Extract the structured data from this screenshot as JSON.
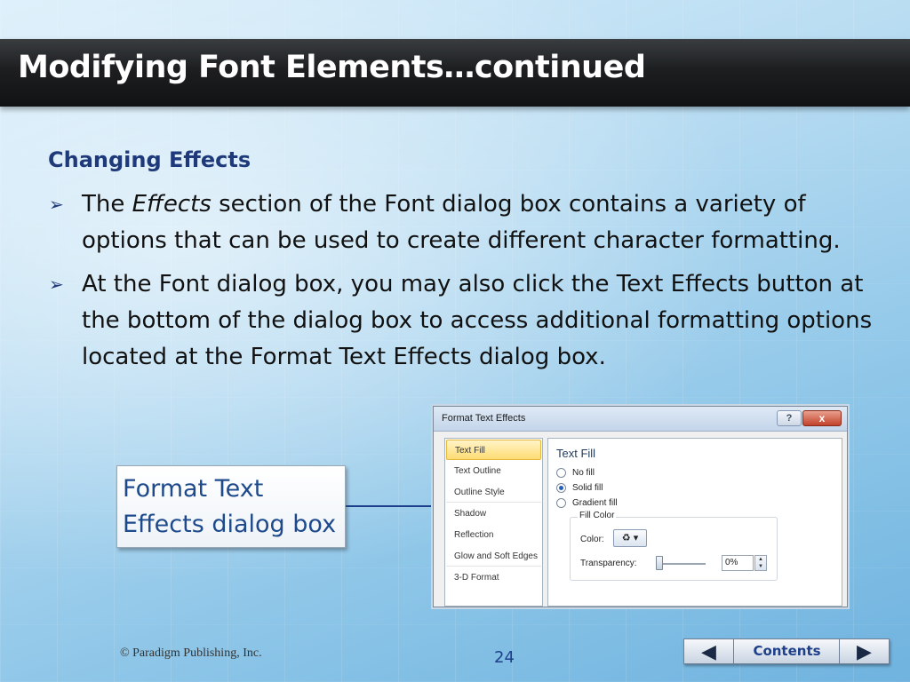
{
  "slide": {
    "title": "Modifying Font Elements…continued",
    "subheading": "Changing Effects",
    "bullets": [
      {
        "marker": "➢",
        "prefix": "The ",
        "emphasis": "Effects",
        "suffix": " section of the Font dialog box contains a variety of options that can be used to create different character formatting."
      },
      {
        "marker": "➢",
        "text": "At the Font dialog box, you may also click the Text Effects button at the bottom of the dialog box to access additional formatting options located at the Format Text Effects dialog box."
      }
    ],
    "callout": {
      "line1": "Format Text",
      "line2": "Effects dialog box"
    }
  },
  "dialog": {
    "title": "Format Text Effects",
    "help_label": "?",
    "close_label": "x",
    "nav_items": [
      "Text Fill",
      "Text Outline",
      "Outline Style",
      "Shadow",
      "Reflection",
      "Glow and Soft Edges",
      "3-D Format"
    ],
    "selected_nav": "Text Fill",
    "panel_heading": "Text Fill",
    "fill_options": [
      {
        "label": "No fill",
        "checked": false
      },
      {
        "label": "Solid fill",
        "checked": true
      },
      {
        "label": "Gradient fill",
        "checked": false
      }
    ],
    "fill_color_group": "Fill Color",
    "color_label": "Color:",
    "transparency_label": "Transparency:",
    "transparency_value": "0%",
    "icons": {
      "paint_bucket": "paint-bucket-icon",
      "dropdown": "chevron-down-icon"
    }
  },
  "footer": {
    "copyright": "© Paradigm Publishing, Inc.",
    "page_number": "24",
    "contents_label": "Contents",
    "prev_label": "◀",
    "next_label": "▶"
  },
  "colors": {
    "title_bar": "#1c1e20",
    "heading_blue": "#1f3a7a",
    "accent_yellow": "#ffdc73"
  }
}
